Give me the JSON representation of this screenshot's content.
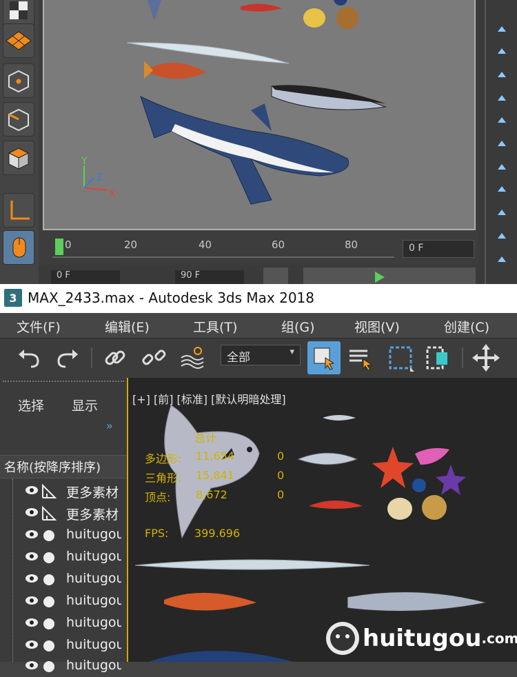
{
  "top_viewport": {
    "axes": {
      "x": "X",
      "y": "Y",
      "z": "Z"
    },
    "timeline_ticks": [
      "0",
      "20",
      "40",
      "60",
      "80"
    ],
    "current_frame": "0 F",
    "field_left": "0 F",
    "field_right": "90 F"
  },
  "window": {
    "title": "MAX_2433.max - Autodesk 3ds Max 2018",
    "icon_label": "3"
  },
  "menu": {
    "items": [
      "文件(F)",
      "编辑(E)",
      "工具(T)",
      "组(G)",
      "视图(V)",
      "创建(C)"
    ]
  },
  "toolbar": {
    "selection_filter": "全部"
  },
  "explorer": {
    "tabs": [
      "选择",
      "显示"
    ],
    "more_glyph": "»",
    "column_header": "名称(按降序排序)",
    "rows": [
      {
        "name": "更多素材",
        "type": "helper"
      },
      {
        "name": "更多素材",
        "type": "helper"
      },
      {
        "name": "huitugou",
        "type": "geometry"
      },
      {
        "name": "huitugou",
        "type": "geometry"
      },
      {
        "name": "huitugou",
        "type": "geometry"
      },
      {
        "name": "huitugou",
        "type": "geometry"
      },
      {
        "name": "huitugou",
        "type": "geometry"
      },
      {
        "name": "huitugou",
        "type": "geometry"
      },
      {
        "name": "huitugou",
        "type": "geometry"
      }
    ]
  },
  "viewport": {
    "label": "[+] [前] [标准] [默认明暗处理]",
    "stats": {
      "title": "总计",
      "polygons_label": "多边形:",
      "polygons_value": "11,654",
      "polygons_sel": "0",
      "triangles_label": "三角形:",
      "triangles_value": "15,841",
      "triangles_sel": "0",
      "vertices_label": "顶点:",
      "vertices_value": "8,672",
      "vertices_sel": "0",
      "fps_label": "FPS:",
      "fps_value": "399.696"
    }
  },
  "watermark": {
    "brand": "huitugou",
    "suffix": ".com"
  },
  "colors": {
    "accent": "#d6a700",
    "active_tool": "#5aa0d8",
    "stat_text": "#d4b200"
  }
}
